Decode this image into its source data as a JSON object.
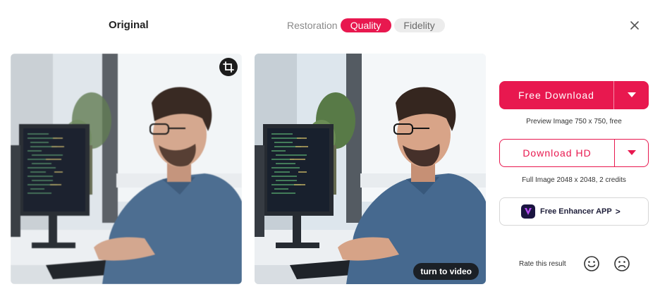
{
  "header": {
    "original_title": "Original",
    "mode_label": "Restoration",
    "tabs": [
      {
        "label": "Quality",
        "active": true
      },
      {
        "label": "Fidelity",
        "active": false
      }
    ],
    "close_icon": "close-icon"
  },
  "images": {
    "left": {
      "crop_icon": "crop-icon"
    },
    "right": {
      "video_button_label": "turn to video"
    }
  },
  "actions": {
    "free_download_label": "Free Download",
    "free_download_caption": "Preview Image 750 x 750, free",
    "download_hd_label": "Download HD",
    "download_hd_caption": "Full Image 2048 x 2048, 2 credits",
    "app_label": "Free Enhancer APP",
    "app_chevron": ">"
  },
  "rating": {
    "label": "Rate this result",
    "icons": [
      "smile-icon",
      "frown-icon"
    ]
  },
  "colors": {
    "accent": "#e8184f",
    "pill_inactive": "#ececec",
    "dark": "#1c1c1c"
  }
}
